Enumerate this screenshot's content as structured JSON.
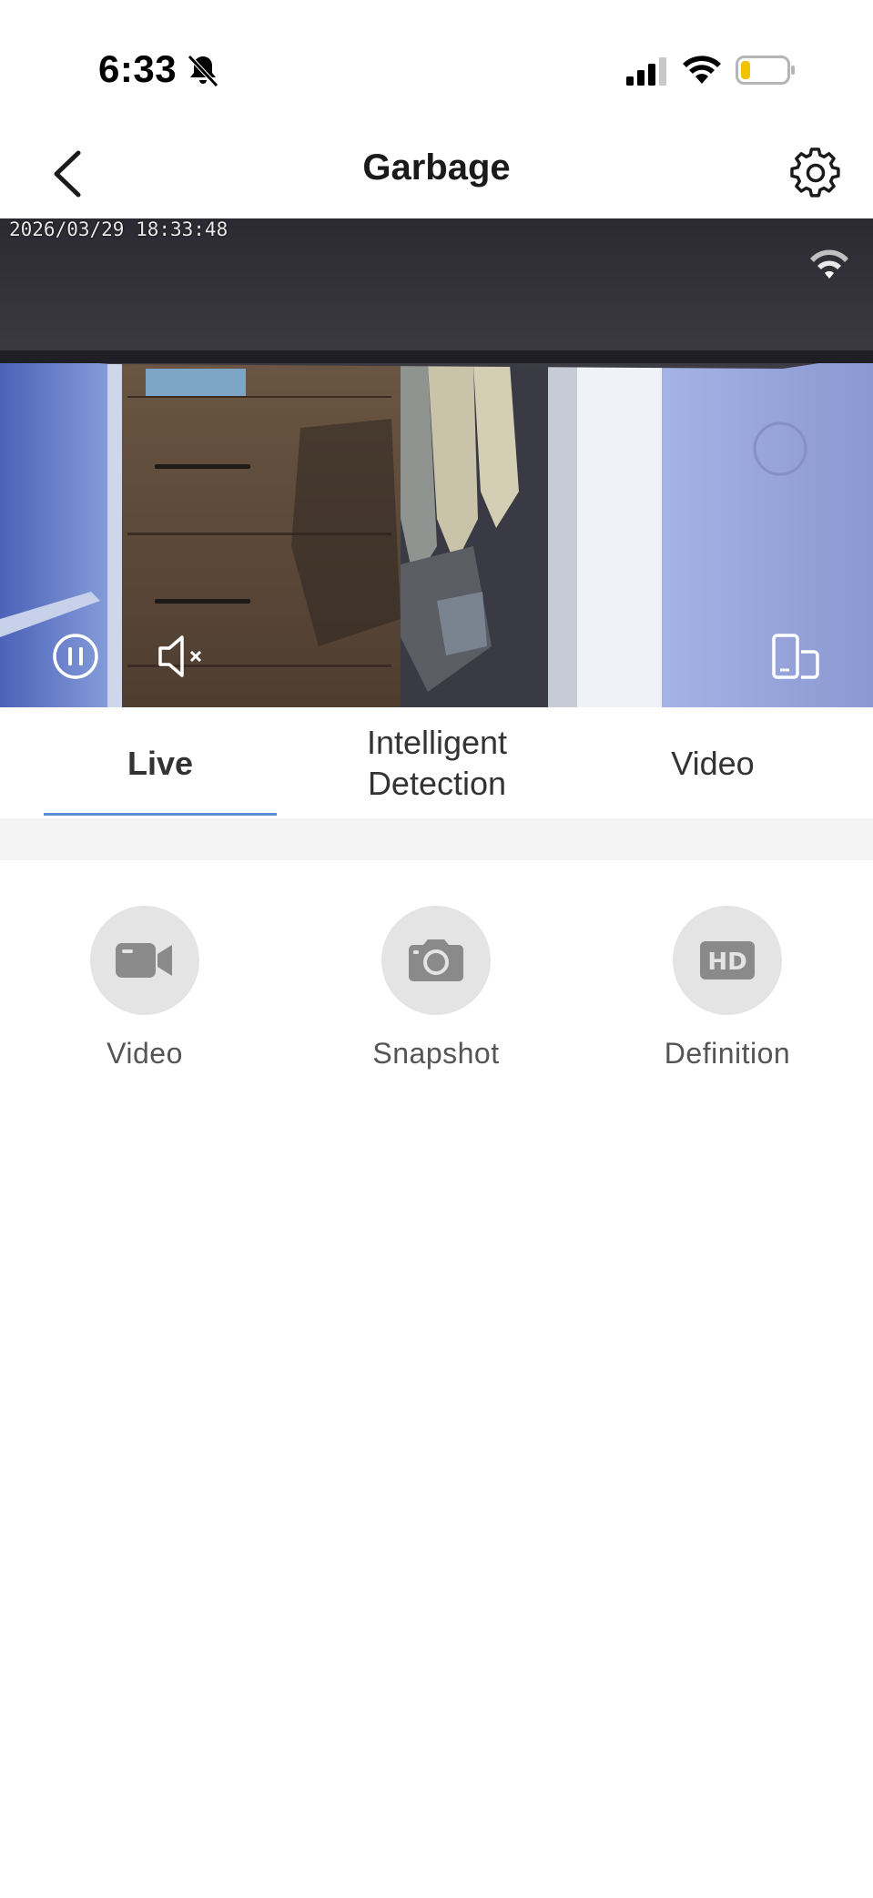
{
  "status_bar": {
    "time": "6:33"
  },
  "header": {
    "title": "Garbage"
  },
  "camera": {
    "timestamp": "2026/03/29 18:33:48"
  },
  "tabs": [
    {
      "label": "Live",
      "active": true
    },
    {
      "label": "Intelligent\nDetection",
      "active": false
    },
    {
      "label": "Video",
      "active": false
    }
  ],
  "actions": [
    {
      "label": "Video",
      "icon": "video-camera-icon"
    },
    {
      "label": "Snapshot",
      "icon": "camera-icon"
    },
    {
      "label": "Definition",
      "icon": "hd-icon",
      "icon_text": "HD"
    }
  ],
  "colors": {
    "tab_indicator": "#5b8fd6",
    "action_circle": "#e4e4e4",
    "action_icon": "#8a8a8a",
    "battery_level": "#f2c200"
  }
}
